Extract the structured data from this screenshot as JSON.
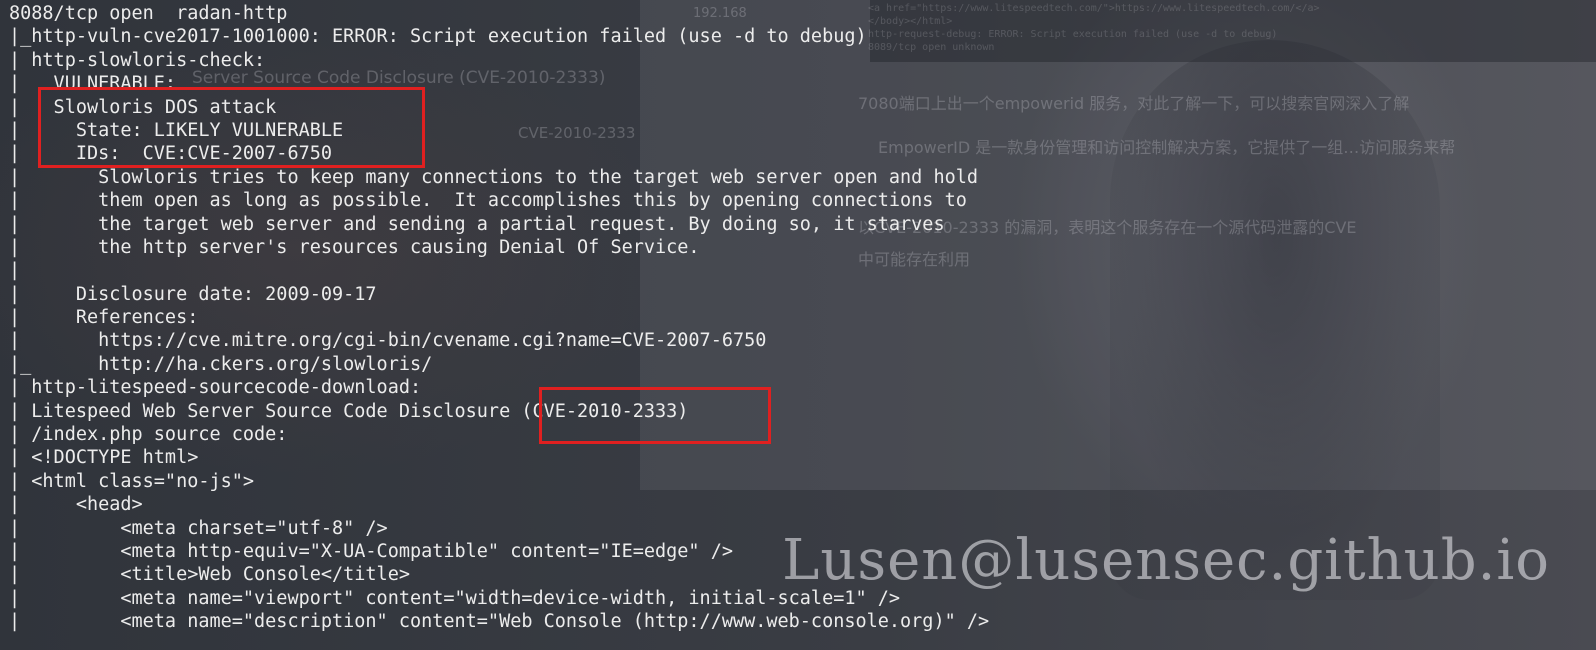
{
  "terminal": {
    "lines": [
      "8088/tcp open  radan-http",
      "|_http-vuln-cve2017-1001000: ERROR: Script execution failed (use -d to debug)",
      "| http-slowloris-check:",
      "|   VULNERABLE:",
      "|   Slowloris DOS attack",
      "|     State: LIKELY VULNERABLE",
      "|     IDs:  CVE:CVE-2007-6750",
      "|       Slowloris tries to keep many connections to the target web server open and hold",
      "|       them open as long as possible.  It accomplishes this by opening connections to",
      "|       the target web server and sending a partial request. By doing so, it starves",
      "|       the http server's resources causing Denial Of Service.",
      "|",
      "|     Disclosure date: 2009-09-17",
      "|     References:",
      "|       https://cve.mitre.org/cgi-bin/cvename.cgi?name=CVE-2007-6750",
      "|_      http://ha.ckers.org/slowloris/",
      "| http-litespeed-sourcecode-download:",
      "| Litespeed Web Server Source Code Disclosure (CVE-2010-2333)",
      "| /index.php source code:",
      "| <!DOCTYPE html>",
      "| <html class=\"no-js\">",
      "|     <head>",
      "|         <meta charset=\"utf-8\" />",
      "|         <meta http-equiv=\"X-UA-Compatible\" content=\"IE=edge\" />",
      "|         <title>Web Console</title>",
      "|         <meta name=\"viewport\" content=\"width=device-width, initial-scale=1\" />",
      "|         <meta name=\"description\" content=\"Web Console (http://www.web-console.org)\" />"
    ]
  },
  "background_window": {
    "heading": "Server Source Code Disclosure (CVE-2010-2333)",
    "subheading": "CVE-2010-2333",
    "para1": "7080端口上出一个empowerid 服务，对此了解一下，可以搜索官网深入了解",
    "para2": "EmpowerID 是一款身份管理和访问控制解决方案，它提供了一组…访问服务来帮",
    "para3": "以CVE-2010-2333 的漏洞，表明这个服务存在一个源代码泄露的CVE",
    "para4": "中可能存在利用",
    "code1": "<a href=\"https://www.litespeedtech.com/\">https://www.litespeedtech.com/</a>",
    "code2": "</body></html>",
    "code3": "http-request-debug: ERROR: Script execution failed (use -d to debug)",
    "code4": "8089/tcp open  unknown",
    "search_fragment": "192.168"
  },
  "watermark": "Lusen@lusensec.github.io",
  "colors": {
    "terminal_text": "#ececec",
    "terminal_bg": "#2b2f36",
    "highlight_box": "#e02020"
  }
}
